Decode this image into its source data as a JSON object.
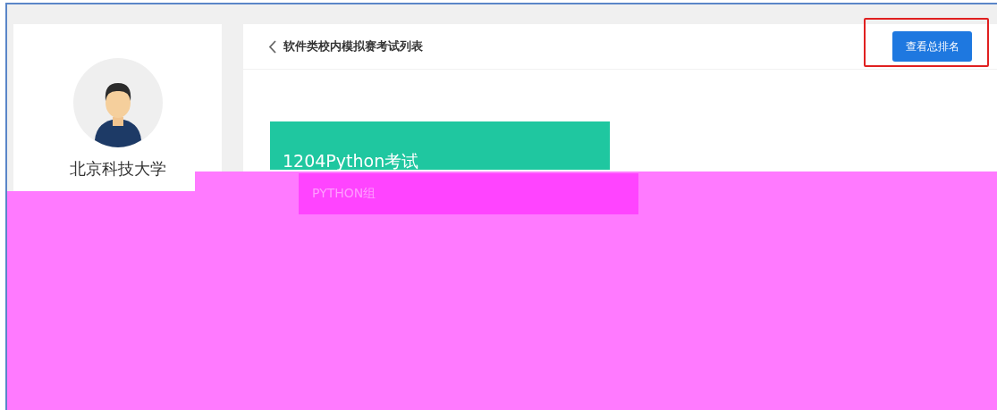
{
  "profile": {
    "school": "北京科技大学"
  },
  "header": {
    "title": "软件类校内模拟赛考试列表",
    "button": "查看总排名",
    "highlighted": true
  },
  "exams": [
    {
      "title": "1204Python考试",
      "group": "PYTHON组"
    }
  ]
}
